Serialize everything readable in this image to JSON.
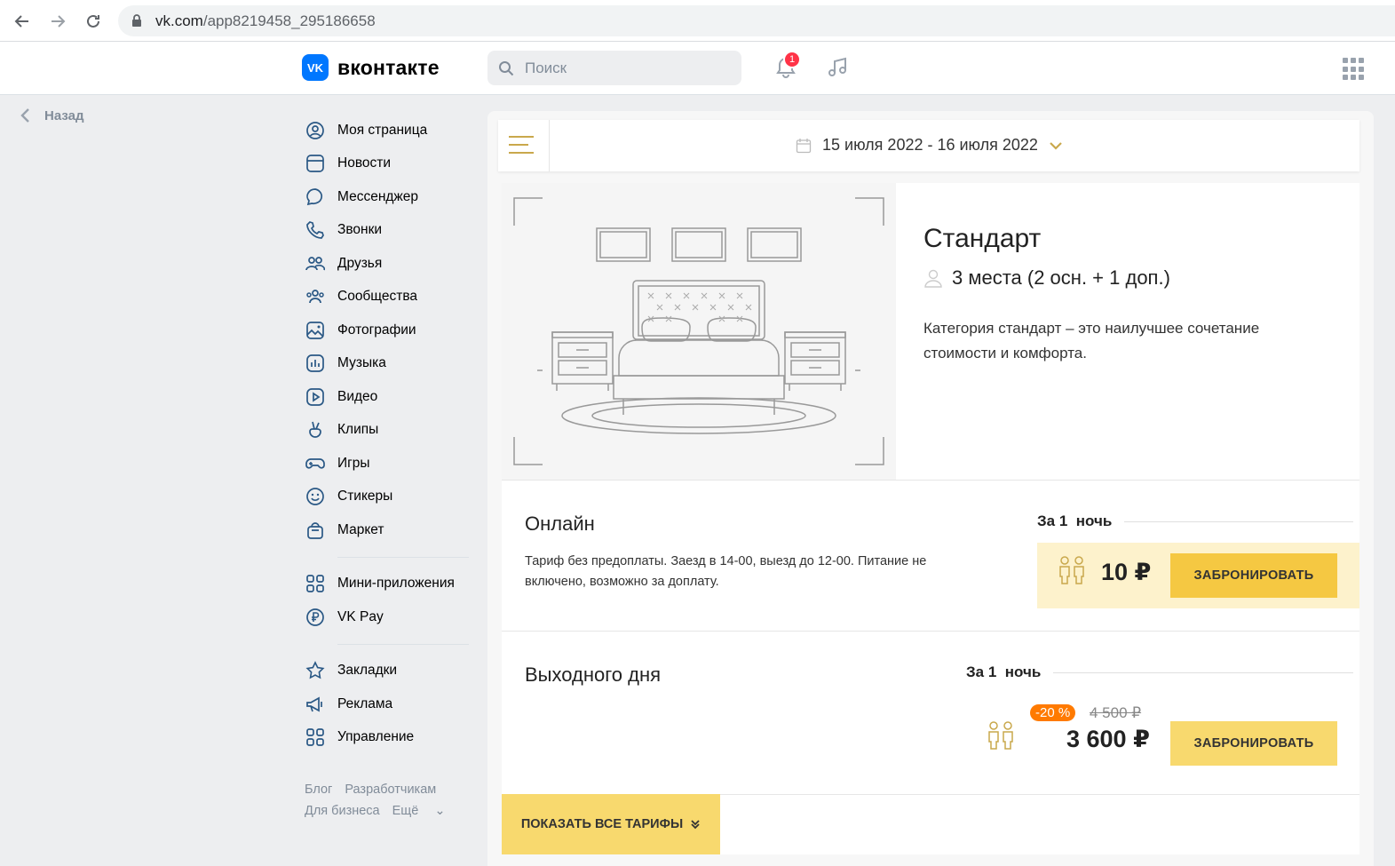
{
  "browser": {
    "url_host": "vk.com",
    "url_path": "/app8219458_295186658"
  },
  "header": {
    "logo_mark": "VK",
    "logo_text": "вконтакте",
    "search_placeholder": "Поиск",
    "notifications_count": "1"
  },
  "back_label": "Назад",
  "sidebar": {
    "items": [
      {
        "label": "Моя страница",
        "icon": "user-circle-icon"
      },
      {
        "label": "Новости",
        "icon": "news-icon"
      },
      {
        "label": "Мессенджер",
        "icon": "message-icon"
      },
      {
        "label": "Звонки",
        "icon": "phone-icon"
      },
      {
        "label": "Друзья",
        "icon": "friends-icon"
      },
      {
        "label": "Сообщества",
        "icon": "communities-icon"
      },
      {
        "label": "Фотографии",
        "icon": "photo-icon"
      },
      {
        "label": "Музыка",
        "icon": "music-icon"
      },
      {
        "label": "Видео",
        "icon": "video-icon"
      },
      {
        "label": "Клипы",
        "icon": "clips-icon"
      },
      {
        "label": "Игры",
        "icon": "gamepad-icon"
      },
      {
        "label": "Стикеры",
        "icon": "smile-icon"
      },
      {
        "label": "Маркет",
        "icon": "bag-icon"
      }
    ],
    "items2": [
      {
        "label": "Мини-приложения",
        "icon": "apps-icon"
      },
      {
        "label": "VK Pay",
        "icon": "ruble-icon"
      }
    ],
    "items3": [
      {
        "label": "Закладки",
        "icon": "star-icon"
      },
      {
        "label": "Реклама",
        "icon": "megaphone-icon"
      },
      {
        "label": "Управление",
        "icon": "apps-icon"
      }
    ],
    "footer": {
      "blog": "Блог",
      "developers": "Разработчикам",
      "business": "Для бизнеса",
      "more": "Ещё"
    }
  },
  "booking": {
    "date_range": "15 июля 2022 - 16 июля 2022",
    "room": {
      "title": "Стандарт",
      "capacity": "3 места (2 осн. + 1 доп.)",
      "description": "Категория стандарт – это наилучшее сочетание стоимости и комфорта."
    },
    "tariffs": [
      {
        "name": "Онлайн",
        "description": "Тариф без предоплаты. Заезд в 14-00, выезд до 12-00. Питание не включено, возможно за доплату.",
        "per_night": "За 1  ночь",
        "price": "10 ₽",
        "button": "ЗАБРОНИРОВАТЬ"
      },
      {
        "name": "Выходного дня",
        "per_night": "За 1  ночь",
        "discount": "-20 %",
        "old_price": "4 500 ₽",
        "price": "3 600 ₽",
        "button": "ЗАБРОНИРОВАТЬ"
      }
    ],
    "show_all": "ПОКАЗАТЬ ВСЕ ТАРИФЫ"
  },
  "colors": {
    "vk_blue": "#0077ff",
    "accent_gold": "#c9a84c",
    "button_yellow": "#f5c842",
    "discount_orange": "#ff7a00",
    "badge_red": "#ff3347"
  }
}
